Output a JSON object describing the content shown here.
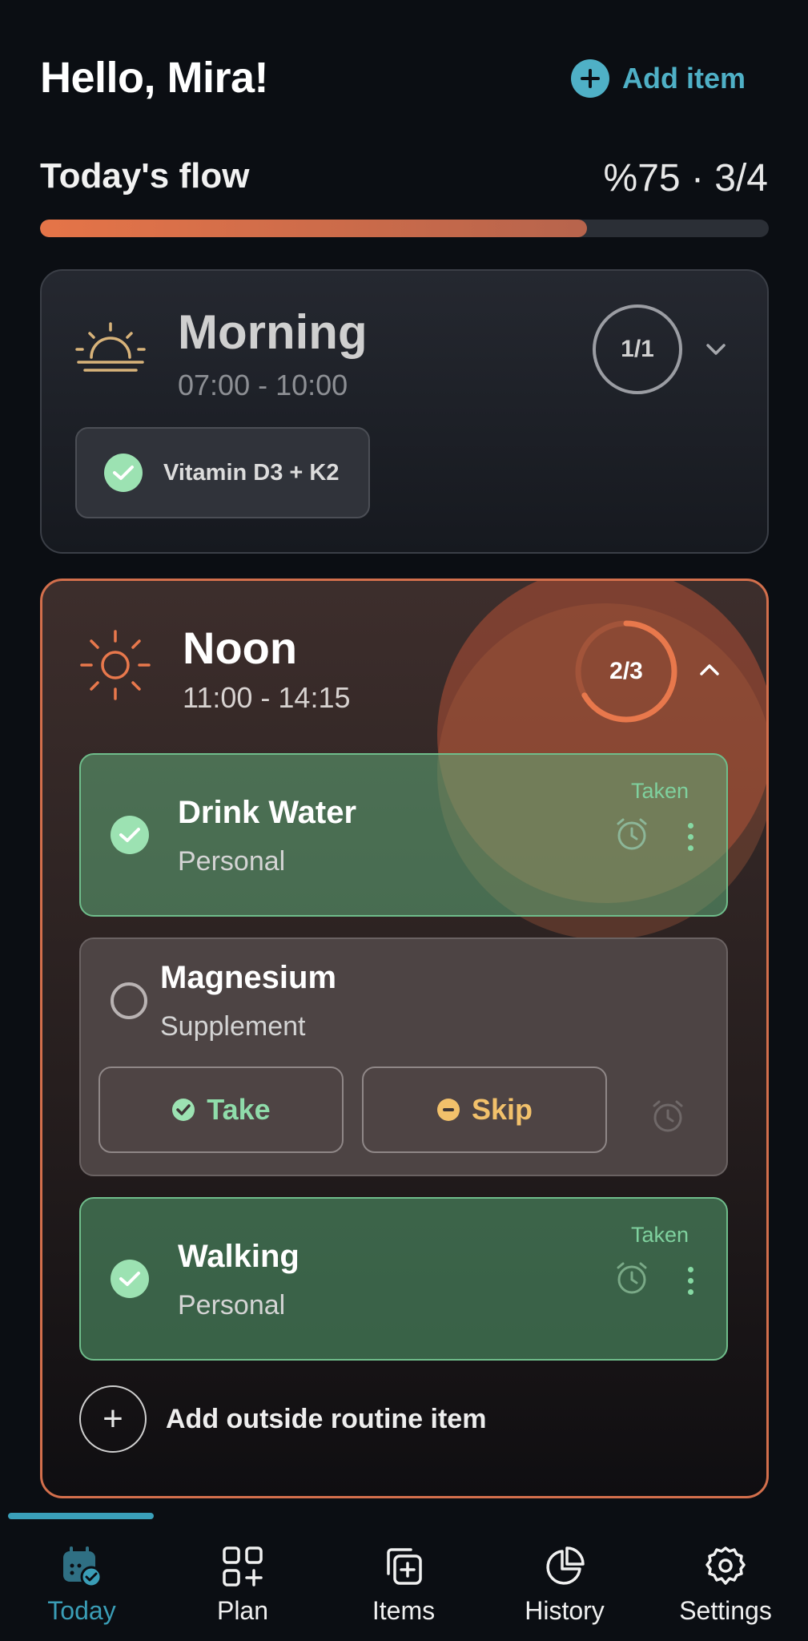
{
  "header": {
    "greeting": "Hello, Mira!",
    "add_item_label": "Add item"
  },
  "flow": {
    "label": "Today's flow",
    "value_text": "%75 · 3/4",
    "progress_fraction": 0.75
  },
  "morning": {
    "title": "Morning",
    "time": "07:00 - 10:00",
    "progress": "1/1",
    "chips": [
      {
        "label": "Vitamin D3 + K2",
        "status": "taken"
      }
    ]
  },
  "noon": {
    "title": "Noon",
    "time": "11:00 - 14:15",
    "progress": "2/3",
    "progress_fraction": 0.667,
    "items": [
      {
        "title": "Drink Water",
        "subtitle": "Personal",
        "status_label": "Taken"
      },
      {
        "title": "Magnesium",
        "subtitle": "Supplement",
        "take_label": "Take",
        "skip_label": "Skip"
      },
      {
        "title": "Walking",
        "subtitle": "Personal",
        "status_label": "Taken"
      }
    ],
    "add_outside_label": "Add outside routine item"
  },
  "nav": {
    "items": [
      {
        "label": "Today",
        "icon": "calendar-check-icon",
        "active": true
      },
      {
        "label": "Plan",
        "icon": "grid-plus-icon",
        "active": false
      },
      {
        "label": "Items",
        "icon": "stacked-add-icon",
        "active": false
      },
      {
        "label": "History",
        "icon": "pie-chart-icon",
        "active": false
      },
      {
        "label": "Settings",
        "icon": "gear-icon",
        "active": false
      }
    ]
  },
  "colors": {
    "accent": "#4fb0c6",
    "progress": "#e57448",
    "noon_border": "#d36f4c",
    "taken_green": "#7fd19e",
    "skip_amber": "#f2c16b"
  }
}
